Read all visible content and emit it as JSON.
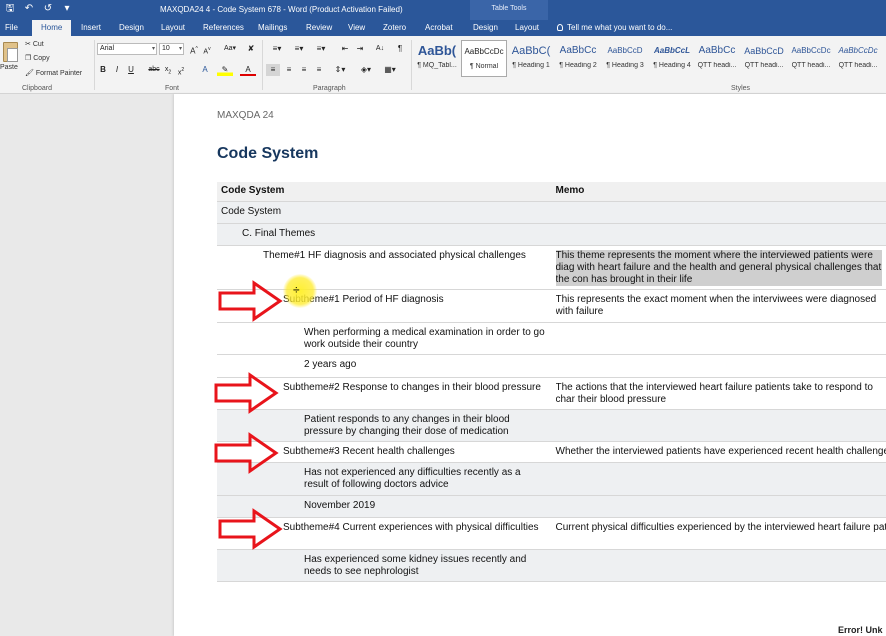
{
  "window": {
    "title": "MAXQDA24 4 - Code System 678 - Word (Product Activation Failed)",
    "context_tab": "Table Tools"
  },
  "ribbon_tabs": [
    {
      "label": "File",
      "active": false
    },
    {
      "label": "Home",
      "active": true
    },
    {
      "label": "Insert",
      "active": false
    },
    {
      "label": "Design",
      "active": false
    },
    {
      "label": "Layout",
      "active": false
    },
    {
      "label": "References",
      "active": false
    },
    {
      "label": "Mailings",
      "active": false
    },
    {
      "label": "Review",
      "active": false
    },
    {
      "label": "View",
      "active": false
    },
    {
      "label": "Zotero",
      "active": false
    },
    {
      "label": "Acrobat",
      "active": false
    },
    {
      "label": "Design",
      "active": false
    },
    {
      "label": "Layout",
      "active": false
    }
  ],
  "tell_me": "Tell me what you want to do...",
  "clipboard": {
    "paste": "Paste",
    "cut": "Cut",
    "copy": "Copy",
    "format_painter": "Format Painter",
    "group": "Clipboard"
  },
  "font": {
    "name": "Arial",
    "size": "10",
    "group": "Font"
  },
  "paragraph": {
    "group": "Paragraph"
  },
  "styles": {
    "group": "Styles",
    "items": [
      {
        "sample": "AaBb(",
        "name": "¶ MQ_Tabl...",
        "selected": false
      },
      {
        "sample": "AaBbCcDc",
        "name": "¶ Normal",
        "selected": true
      },
      {
        "sample": "AaBbC(",
        "name": "¶ Heading 1",
        "selected": false
      },
      {
        "sample": "AaBbCc",
        "name": "¶ Heading 2",
        "selected": false
      },
      {
        "sample": "AaBbCcD",
        "name": "¶ Heading 3",
        "selected": false
      },
      {
        "sample": "AaBbCcL",
        "name": "¶ Heading 4",
        "selected": false
      },
      {
        "sample": "AaBbCc",
        "name": "QTT headi...",
        "selected": false
      },
      {
        "sample": "AaBbCcD",
        "name": "QTT headi...",
        "selected": false
      },
      {
        "sample": "AaBbCcDc",
        "name": "QTT headi...",
        "selected": false
      },
      {
        "sample": "AaBbCcDc",
        "name": "QTT headi...",
        "selected": false
      }
    ]
  },
  "document": {
    "header_text": "MAXQDA 24",
    "title": "Code System",
    "table": {
      "headers": [
        "Code System",
        "Memo"
      ],
      "rows": [
        {
          "indent": 0,
          "code": "Code System",
          "memo": ""
        },
        {
          "indent": 1,
          "code": "C. Final Themes",
          "memo": ""
        },
        {
          "indent": 2,
          "code": "Theme#1 HF diagnosis and associated physical challenges",
          "memo": "This theme represents the moment where the interviewed patients were diag with heart failure and the health and general physical challenges that the con has brought in their life",
          "highlight": true
        },
        {
          "indent": 3,
          "code": "Subtheme#1 Period of HF diagnosis",
          "memo": "This represents the exact moment when the interviwees were diagnosed with failure"
        },
        {
          "indent": 4,
          "code": "When performing a medical examination in order to go work outside their country",
          "memo": ""
        },
        {
          "indent": 4,
          "code": "2 years ago",
          "memo": ""
        },
        {
          "indent": 3,
          "code": "Subtheme#2 Response to changes in their blood pressure",
          "memo": "The actions that the interviewed heart failure patients take to respond to char their blood pressure"
        },
        {
          "indent": 4,
          "code": "Patient responds to any changes in their blood pressure by changing their dose of medication",
          "memo": ""
        },
        {
          "indent": 3,
          "code": "Subtheme#3 Recent health challenges",
          "memo": "Whether the interviewed patients have experienced recent health challenges"
        },
        {
          "indent": 4,
          "code": "Has not experienced any difficulties recently as a result of following doctors advice",
          "memo": ""
        },
        {
          "indent": 4,
          "code": "November 2019",
          "memo": ""
        },
        {
          "indent": 3,
          "code": "Subtheme#4 Current experiences with physical difficulties",
          "memo": "Current physical difficulties experienced by the interviewed heart failure patie"
        },
        {
          "indent": 4,
          "code": "Has experienced some kidney issues recently and needs to see nephrologist",
          "memo": ""
        }
      ]
    }
  },
  "status": {
    "error": "Error! Unk"
  },
  "colors": {
    "title_bar": "#2b579a",
    "arrow": "#e8141b",
    "heading": "#17375e"
  }
}
